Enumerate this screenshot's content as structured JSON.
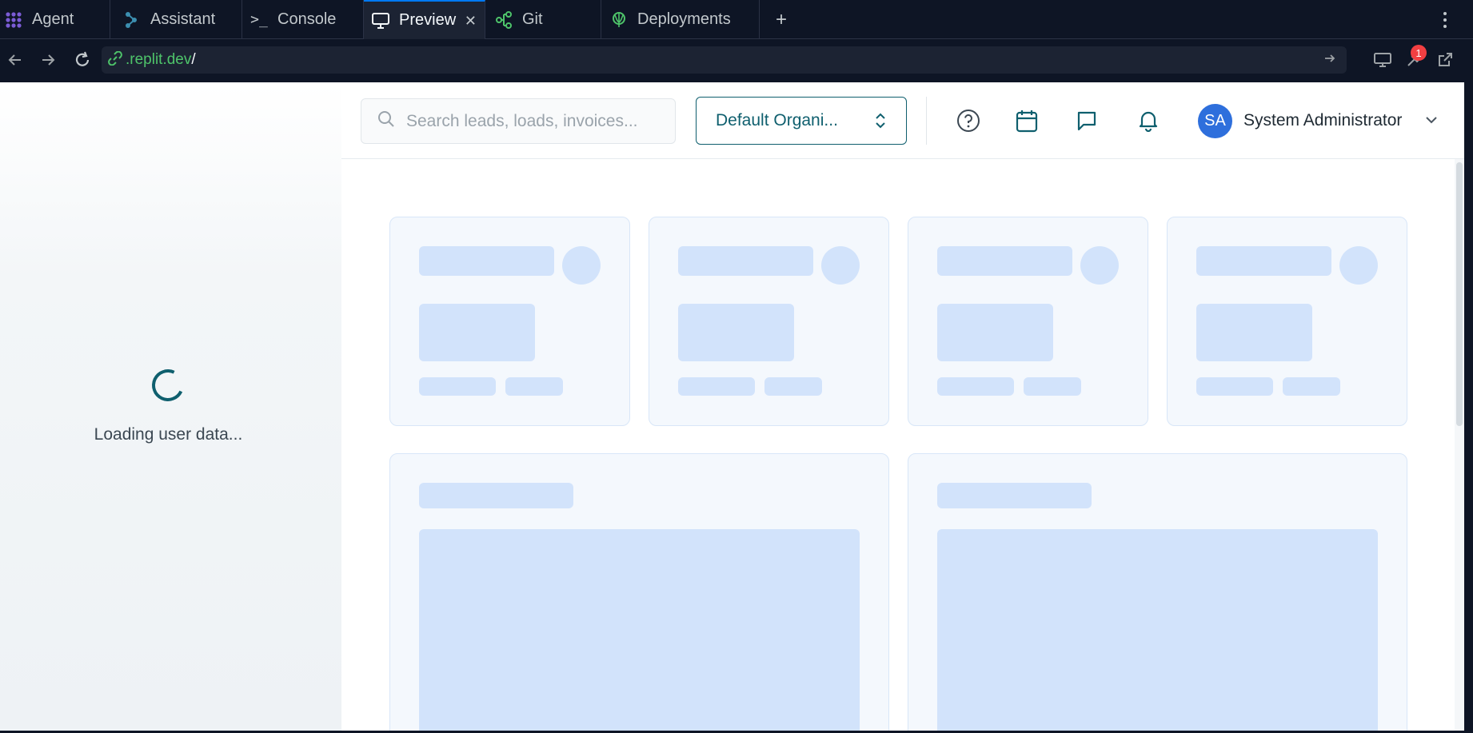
{
  "tabs": [
    {
      "label": "Agent",
      "icon": "agent-icon"
    },
    {
      "label": "Assistant",
      "icon": "assistant-icon"
    },
    {
      "label": "Console",
      "icon": "console-icon"
    },
    {
      "label": "Preview",
      "icon": "monitor-icon",
      "active": true
    },
    {
      "label": "Git",
      "icon": "git-branch-icon"
    },
    {
      "label": "Deployments",
      "icon": "deployments-icon"
    }
  ],
  "address_bar": {
    "host": ".replit.dev",
    "path": "/"
  },
  "notification_badge": "1",
  "app": {
    "loading_text": "Loading user data...",
    "search_placeholder": "Search leads, loads, invoices...",
    "org_selector": "Default Organi...",
    "user": {
      "initials": "SA",
      "name": "System Administrator"
    }
  },
  "colors": {
    "ide_bg": "#0e1525",
    "accent_teal": "#0f5f6e",
    "avatar_blue": "#2e6fdc",
    "skeleton": "#d2e3fb",
    "url_green": "#4ec46a",
    "badge_red": "#f23f42"
  }
}
